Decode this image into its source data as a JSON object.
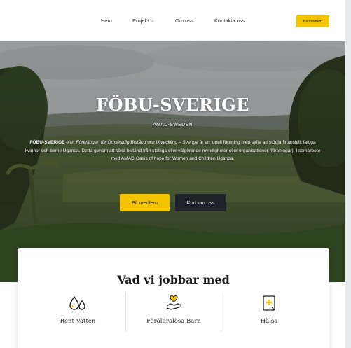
{
  "nav": {
    "items": [
      {
        "label": "Hem"
      },
      {
        "label": "Projekt",
        "has_dropdown": true
      },
      {
        "label": "Om oss"
      },
      {
        "label": "Kontakta oss"
      }
    ],
    "cta_label": "Bli medlem"
  },
  "hero": {
    "title": "FÖBU-SVERIGE",
    "subtitle": "AMAD-SWEDEN",
    "description": {
      "bold_lead": "FÖBU-SVERIGE",
      "text_1": " eller ",
      "italic_name": "Föreningen för Ömsesidig Bistånd och Utveckling – Sverige",
      "text_2": " är en ideell förening med syfte att stödja finansiellt fattiga kvinnor och barn i Uganda. Detta genom att söka bistånd från statliga eller välgörande myndigheter eller organisationer (föreningar), I samarbete med AMAD Oasis of hope for Women and Children Uganda."
    },
    "primary_button": "Bli medlem",
    "secondary_button": "Kort om oss"
  },
  "services": {
    "title": "Vad vi jobbar med",
    "items": [
      {
        "label": "Rent Vatten",
        "icon": "water-drops-icon"
      },
      {
        "label": "Föräldralösa Barn",
        "icon": "heart-hand-icon"
      },
      {
        "label": "Hälsa",
        "icon": "health-document-icon"
      }
    ]
  },
  "colors": {
    "accent": "#f5c400",
    "dark_button": "#1e2229"
  }
}
